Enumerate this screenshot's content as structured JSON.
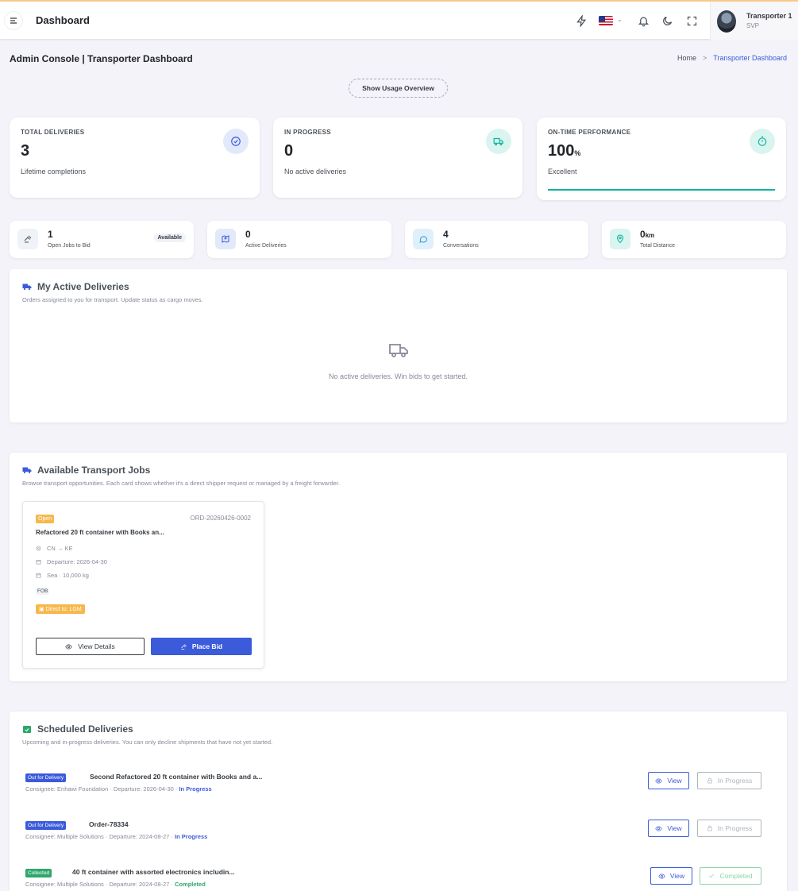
{
  "topbar": {
    "title": "Dashboard",
    "user": {
      "name": "Transporter 1",
      "role": "SVP"
    }
  },
  "page": {
    "title": "Admin Console | Transporter Dashboard",
    "breadcrumb": {
      "home": "Home",
      "separator": ">",
      "current": "Transporter Dashboard"
    },
    "usage_button": "Show Usage Overview"
  },
  "stats": [
    {
      "label": "TOTAL DELIVERIES",
      "value": "3",
      "unit": "",
      "sub": "Lifetime completions",
      "icon": "check-circle-icon",
      "color": "#405189",
      "bg": "#e2e9fb"
    },
    {
      "label": "IN PROGRESS",
      "value": "0",
      "unit": "",
      "sub": "No active deliveries",
      "icon": "truck-icon",
      "color": "#0ab39c",
      "bg": "#daf4f0"
    },
    {
      "label": "ON-TIME PERFORMANCE",
      "value": "100",
      "unit": "%",
      "sub": "Excellent",
      "icon": "stopwatch-icon",
      "color": "#0ab39c",
      "bg": "#daf4f0",
      "progress": 1.0
    }
  ],
  "mini_stats": [
    {
      "value": "1",
      "unit": "",
      "label": "Open Jobs to Bid",
      "badge": "Available",
      "icon": "gavel-icon",
      "color": "#495057",
      "bg": "#eff2f7"
    },
    {
      "value": "0",
      "unit": "",
      "label": "Active Deliveries",
      "icon": "map-pin-icon",
      "color": "#405189",
      "bg": "#e2e9fb"
    },
    {
      "value": "4",
      "unit": "",
      "label": "Conversations",
      "icon": "chat-icon",
      "color": "#299cdb",
      "bg": "#dff0fa"
    },
    {
      "value": "0",
      "unit": "km",
      "label": "Total Distance",
      "icon": "location-icon",
      "color": "#0ab39c",
      "bg": "#daf4f0"
    }
  ],
  "active_deliveries": {
    "title": "My Active Deliveries",
    "description": "Orders assigned to you for transport. Update status as cargo moves.",
    "empty_text": "No active deliveries. Win bids to get started."
  },
  "transport_jobs": {
    "title": "Available Transport Jobs",
    "description": "Browse transport opportunities. Each card shows whether it's a direct shipper request or managed by a freight forwarder.",
    "jobs": [
      {
        "status": "Open",
        "order_id": "ORD-20260426-0002",
        "title": "Refactored 20 ft container with Books an...",
        "route": "CN   → KE",
        "departure": "Departure: 2026-04-30",
        "mode": "Sea · 10,000 kg",
        "incoterm": "FOB",
        "direct": "Direct to: LGM",
        "view_label": "View Details",
        "bid_label": "Place Bid"
      }
    ]
  },
  "scheduled": {
    "title": "Scheduled Deliveries",
    "description": "Upcoming and in-progress deliveries. You can only decline shipments that have not yet started.",
    "items": [
      {
        "badge": "Out for Delivery",
        "badge_color": "#3b5bdb",
        "title": "Second Refactored 20 ft container with Books and a...",
        "consignee": "Consignee: Enhawi Foundation · Departure: 2026-04-30 ·",
        "status": "In Progress",
        "status_color": "#3b5bdb",
        "view_label": "View",
        "state_label": "In Progress",
        "state_icon": "lock-icon",
        "state_color": "#adb5bd"
      },
      {
        "badge": "Out for Delivery",
        "badge_color": "#3b5bdb",
        "title": "Order-78334",
        "consignee": "Consignee: Multiple Solutions · Departure: 2024-08-27 ·",
        "status": "In Progress",
        "status_color": "#3b5bdb",
        "view_label": "View",
        "state_label": "In Progress",
        "state_icon": "lock-icon",
        "state_color": "#adb5bd"
      },
      {
        "badge": "Collected",
        "badge_color": "#2ea86a",
        "title": "40 ft container with assorted electronics includin...",
        "consignee": "Consignee: Multiple Solutions · Departure: 2024-08-27 ·",
        "status": "Completed",
        "status_color": "#2ea86a",
        "view_label": "View",
        "state_label": "Completed",
        "state_icon": "check-icon",
        "state_color": "#8fd4a9"
      }
    ]
  }
}
